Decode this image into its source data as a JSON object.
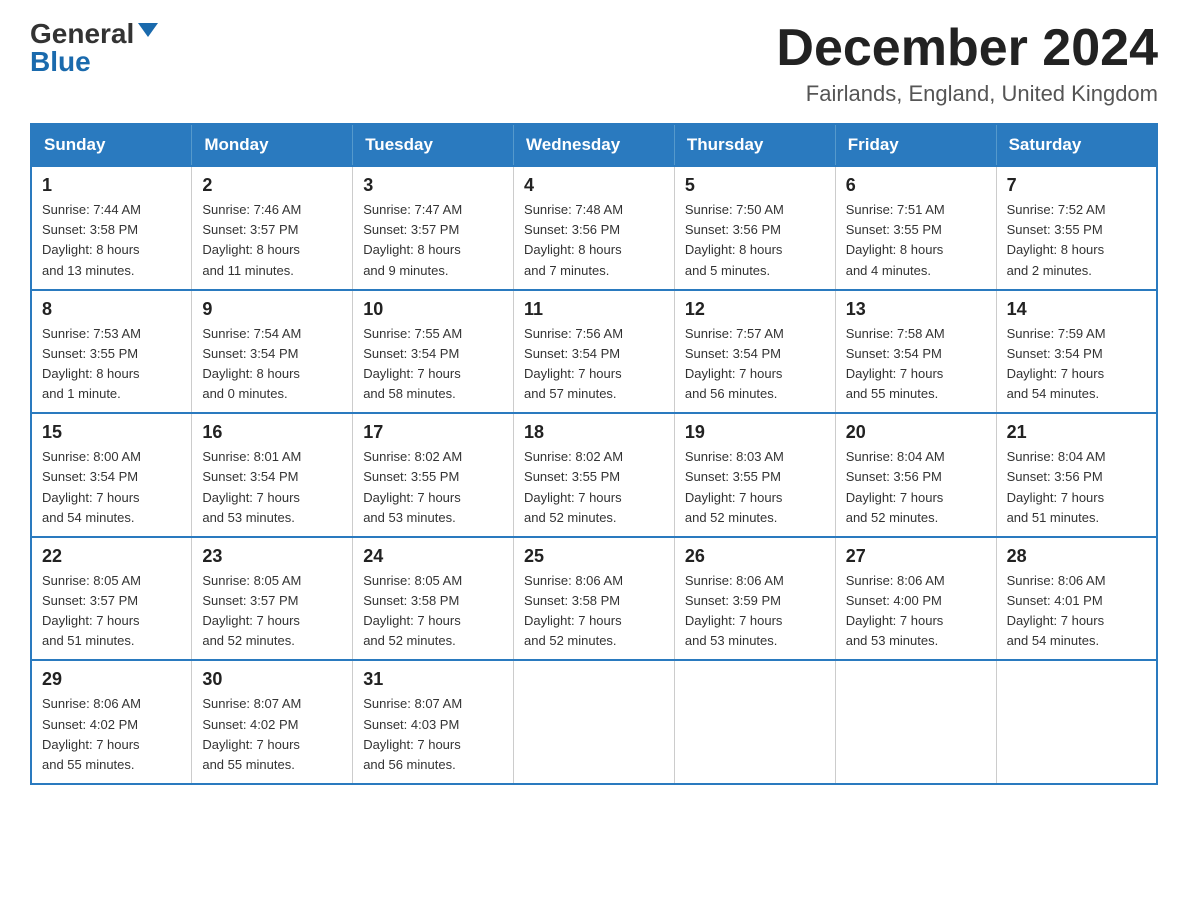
{
  "logo": {
    "general": "General",
    "blue": "Blue"
  },
  "title": "December 2024",
  "subtitle": "Fairlands, England, United Kingdom",
  "days_of_week": [
    "Sunday",
    "Monday",
    "Tuesday",
    "Wednesday",
    "Thursday",
    "Friday",
    "Saturday"
  ],
  "weeks": [
    [
      {
        "day": "1",
        "info": "Sunrise: 7:44 AM\nSunset: 3:58 PM\nDaylight: 8 hours\nand 13 minutes."
      },
      {
        "day": "2",
        "info": "Sunrise: 7:46 AM\nSunset: 3:57 PM\nDaylight: 8 hours\nand 11 minutes."
      },
      {
        "day": "3",
        "info": "Sunrise: 7:47 AM\nSunset: 3:57 PM\nDaylight: 8 hours\nand 9 minutes."
      },
      {
        "day": "4",
        "info": "Sunrise: 7:48 AM\nSunset: 3:56 PM\nDaylight: 8 hours\nand 7 minutes."
      },
      {
        "day": "5",
        "info": "Sunrise: 7:50 AM\nSunset: 3:56 PM\nDaylight: 8 hours\nand 5 minutes."
      },
      {
        "day": "6",
        "info": "Sunrise: 7:51 AM\nSunset: 3:55 PM\nDaylight: 8 hours\nand 4 minutes."
      },
      {
        "day": "7",
        "info": "Sunrise: 7:52 AM\nSunset: 3:55 PM\nDaylight: 8 hours\nand 2 minutes."
      }
    ],
    [
      {
        "day": "8",
        "info": "Sunrise: 7:53 AM\nSunset: 3:55 PM\nDaylight: 8 hours\nand 1 minute."
      },
      {
        "day": "9",
        "info": "Sunrise: 7:54 AM\nSunset: 3:54 PM\nDaylight: 8 hours\nand 0 minutes."
      },
      {
        "day": "10",
        "info": "Sunrise: 7:55 AM\nSunset: 3:54 PM\nDaylight: 7 hours\nand 58 minutes."
      },
      {
        "day": "11",
        "info": "Sunrise: 7:56 AM\nSunset: 3:54 PM\nDaylight: 7 hours\nand 57 minutes."
      },
      {
        "day": "12",
        "info": "Sunrise: 7:57 AM\nSunset: 3:54 PM\nDaylight: 7 hours\nand 56 minutes."
      },
      {
        "day": "13",
        "info": "Sunrise: 7:58 AM\nSunset: 3:54 PM\nDaylight: 7 hours\nand 55 minutes."
      },
      {
        "day": "14",
        "info": "Sunrise: 7:59 AM\nSunset: 3:54 PM\nDaylight: 7 hours\nand 54 minutes."
      }
    ],
    [
      {
        "day": "15",
        "info": "Sunrise: 8:00 AM\nSunset: 3:54 PM\nDaylight: 7 hours\nand 54 minutes."
      },
      {
        "day": "16",
        "info": "Sunrise: 8:01 AM\nSunset: 3:54 PM\nDaylight: 7 hours\nand 53 minutes."
      },
      {
        "day": "17",
        "info": "Sunrise: 8:02 AM\nSunset: 3:55 PM\nDaylight: 7 hours\nand 53 minutes."
      },
      {
        "day": "18",
        "info": "Sunrise: 8:02 AM\nSunset: 3:55 PM\nDaylight: 7 hours\nand 52 minutes."
      },
      {
        "day": "19",
        "info": "Sunrise: 8:03 AM\nSunset: 3:55 PM\nDaylight: 7 hours\nand 52 minutes."
      },
      {
        "day": "20",
        "info": "Sunrise: 8:04 AM\nSunset: 3:56 PM\nDaylight: 7 hours\nand 52 minutes."
      },
      {
        "day": "21",
        "info": "Sunrise: 8:04 AM\nSunset: 3:56 PM\nDaylight: 7 hours\nand 51 minutes."
      }
    ],
    [
      {
        "day": "22",
        "info": "Sunrise: 8:05 AM\nSunset: 3:57 PM\nDaylight: 7 hours\nand 51 minutes."
      },
      {
        "day": "23",
        "info": "Sunrise: 8:05 AM\nSunset: 3:57 PM\nDaylight: 7 hours\nand 52 minutes."
      },
      {
        "day": "24",
        "info": "Sunrise: 8:05 AM\nSunset: 3:58 PM\nDaylight: 7 hours\nand 52 minutes."
      },
      {
        "day": "25",
        "info": "Sunrise: 8:06 AM\nSunset: 3:58 PM\nDaylight: 7 hours\nand 52 minutes."
      },
      {
        "day": "26",
        "info": "Sunrise: 8:06 AM\nSunset: 3:59 PM\nDaylight: 7 hours\nand 53 minutes."
      },
      {
        "day": "27",
        "info": "Sunrise: 8:06 AM\nSunset: 4:00 PM\nDaylight: 7 hours\nand 53 minutes."
      },
      {
        "day": "28",
        "info": "Sunrise: 8:06 AM\nSunset: 4:01 PM\nDaylight: 7 hours\nand 54 minutes."
      }
    ],
    [
      {
        "day": "29",
        "info": "Sunrise: 8:06 AM\nSunset: 4:02 PM\nDaylight: 7 hours\nand 55 minutes."
      },
      {
        "day": "30",
        "info": "Sunrise: 8:07 AM\nSunset: 4:02 PM\nDaylight: 7 hours\nand 55 minutes."
      },
      {
        "day": "31",
        "info": "Sunrise: 8:07 AM\nSunset: 4:03 PM\nDaylight: 7 hours\nand 56 minutes."
      },
      {
        "day": "",
        "info": ""
      },
      {
        "day": "",
        "info": ""
      },
      {
        "day": "",
        "info": ""
      },
      {
        "day": "",
        "info": ""
      }
    ]
  ]
}
